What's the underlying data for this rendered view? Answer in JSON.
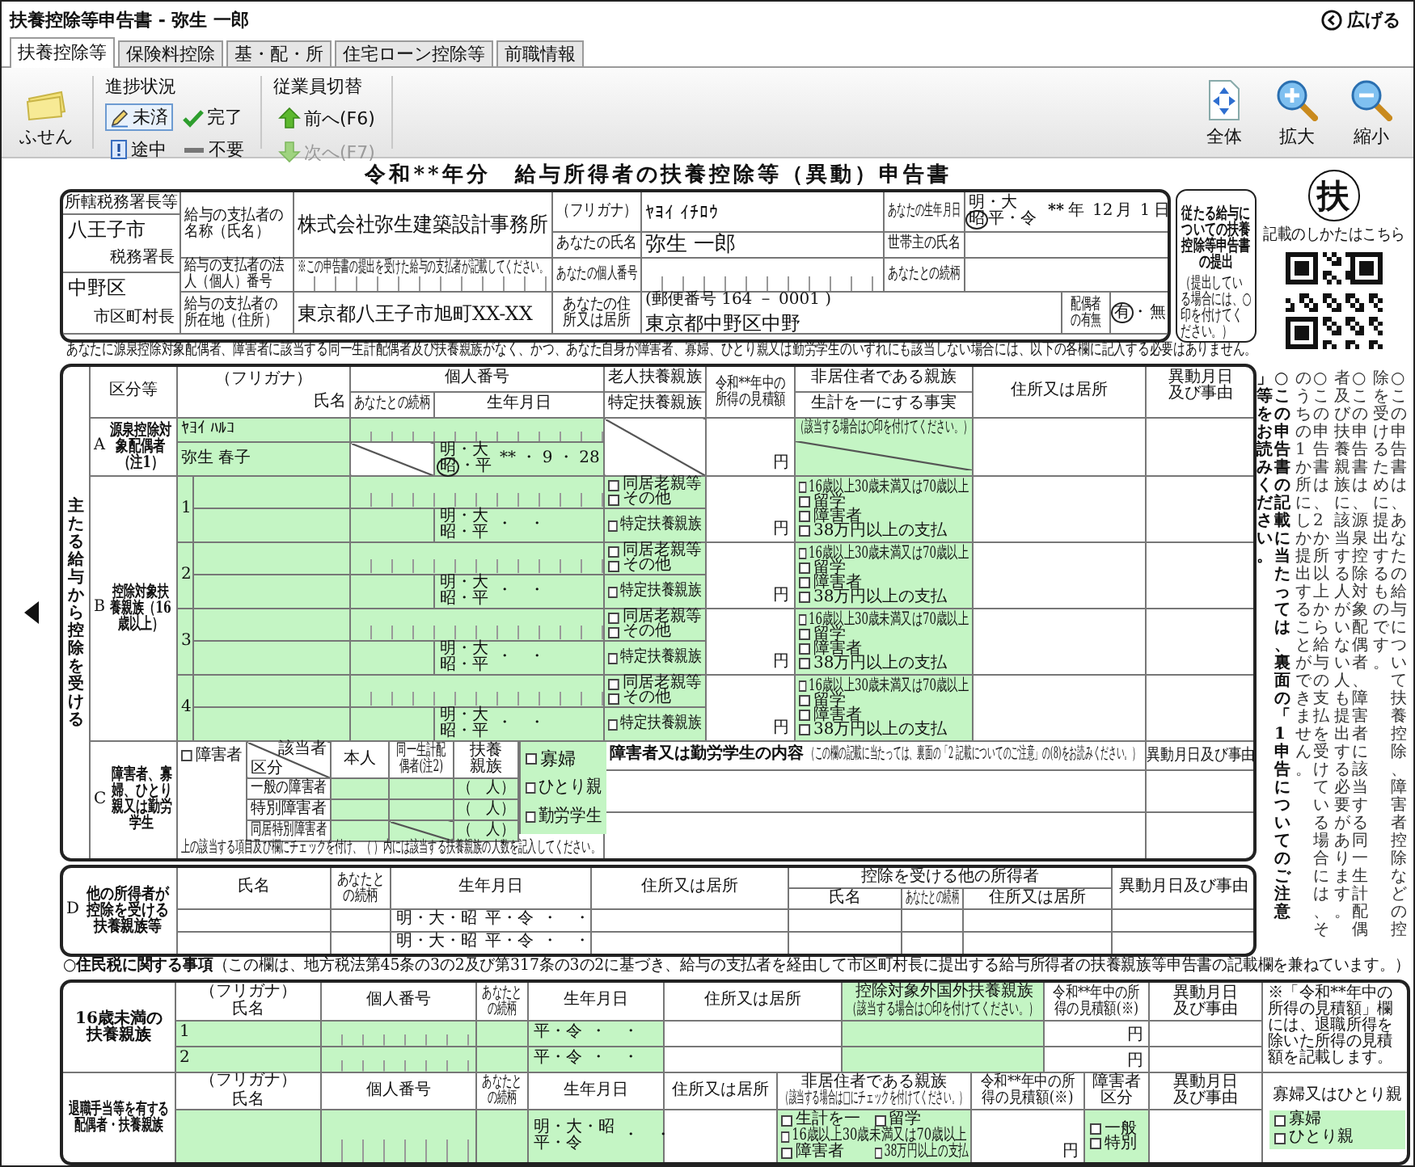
{
  "window": {
    "title": "扶養控除等申告書 - 弥生 一郎",
    "expand_button": "広げる"
  },
  "tabs": [
    {
      "label": "扶養控除等",
      "selected": true
    },
    {
      "label": "保険料控除",
      "selected": false
    },
    {
      "label": "基・配・所",
      "selected": false
    },
    {
      "label": "住宅ローン控除等",
      "selected": false
    },
    {
      "label": "前職情報",
      "selected": false
    }
  ],
  "toolbar": {
    "sticky_note": "ふせん",
    "progress": {
      "title": "進捗状況",
      "items": [
        {
          "label": "未済",
          "kind": "pending",
          "selected": true
        },
        {
          "label": "完了",
          "kind": "done",
          "selected": false
        },
        {
          "label": "途中",
          "kind": "partial",
          "selected": false
        },
        {
          "label": "不要",
          "kind": "unneeded",
          "selected": false
        }
      ]
    },
    "employee_switch": {
      "title": "従業員切替",
      "items": [
        {
          "label": "前へ(F6)",
          "kind": "prev",
          "disabled": false
        },
        {
          "label": "次へ(F7)",
          "kind": "next",
          "disabled": true
        }
      ]
    },
    "view_buttons": [
      {
        "label": "全体",
        "kind": "fit"
      },
      {
        "label": "拡大",
        "kind": "zoom_in"
      },
      {
        "label": "縮小",
        "kind": "zoom_out"
      }
    ]
  },
  "form": {
    "title": "令和**年分　給与所得者の扶養控除等（異動）申告書",
    "header": {
      "tax_office_label": "所轄税務署長等",
      "tax_office": "八王子市",
      "tax_office_suffix": "税務署長",
      "municipality": "中野区",
      "municipality_suffix": "市区町村長",
      "payer_name_label": "給与の支払者の名称（氏名）",
      "payer_name": "株式会社弥生建築設計事務所",
      "payer_number_label": "給与の支払者の法人（個人）番号",
      "payer_number_note": "※この申告書の提出を受けた給与の支払者が記載してください。",
      "payer_address_label": "給与の支払者の所在地（住所）",
      "payer_address": "東京都八王子市旭町XX-XX",
      "furigana_label": "（フリガナ）",
      "furigana": "ﾔﾖｲ ｲﾁﾛｳ",
      "name_label": "あなたの氏名",
      "name": "弥生 一郎",
      "my_number_label": "あなたの個人番号",
      "address_label": "あなたの住所又は居所",
      "postal_code": "(郵便番号 164 － 0001 )",
      "address": "東京都中野区中野",
      "birth_label": "あなたの生年月日",
      "birth_era": [
        {
          "label": "明・大",
          "selected": false
        },
        {
          "label": "昭",
          "selected": true
        },
        {
          "label": "平・令",
          "selected": false
        }
      ],
      "birth_year": "**",
      "year_unit": "年",
      "birth_month": "12",
      "month_unit": "月",
      "birth_day": "1",
      "day_unit": "日",
      "householder_label": "世帯主の氏名",
      "relation_label": "あなたとの続柄",
      "spouse_label": "配偶者の有無",
      "spouse_options": [
        {
          "label": "有",
          "selected": true
        },
        {
          "label": "無",
          "selected": false
        }
      ],
      "spouse_separator": "・",
      "secondary_label": "従たる給与についての扶養控除等申告書の提出",
      "secondary_note": "（提出している場合には、○印を付けてください。）"
    },
    "notice": "あなたに源泉控除対象配偶者、障害者に該当する同一生計配偶者及び扶養親族がなく、かつ、あなた自身が障害者、寡婦、ひとり親又は勤労学生のいずれにも該当しない場合には、以下の各欄に記入する必要はありません。",
    "main": {
      "side_label": "主たる給与から控除を受ける",
      "headers": {
        "category": "区分等",
        "furigana": "（フリガナ）",
        "name": "氏名",
        "number": "個人番号",
        "relation": "あなたとの続柄",
        "birth": "生年月日",
        "elderly": "老人扶養親族",
        "specified": "特定扶養親族",
        "income": "令和**年中の所得の見積額",
        "nonresident": "非居住者である親族",
        "livelihood": "生計を一にする事実",
        "address": "住所又は居所",
        "change": "異動月日及び事由"
      },
      "spouse": {
        "letter": "A",
        "label": "源泉控除対象配偶者（注1）",
        "furigana": "ﾔﾖｲ ﾊﾙｺ",
        "name": "弥生 春子",
        "era": [
          {
            "label": "明・大",
            "selected": false
          },
          {
            "label": "昭",
            "selected": true
          },
          {
            "label": "・平",
            "selected": false
          }
        ],
        "birth": "** ・ 9 ・ 28",
        "yen": "円",
        "note": "（該当する場合は○印を付けてください。）"
      },
      "dependents": {
        "letter": "B",
        "label": "控除対象扶養親族（16歳以上）",
        "rows": [
          {
            "number": "1",
            "era": [
              {
                "label": "明・大",
                "selected": false
              },
              {
                "label": "昭・平",
                "selected": false
              }
            ],
            "birth": "・　・",
            "checks": [
              {
                "label": "同居老親等",
                "checked": false
              },
              {
                "label": "その他",
                "checked": false
              },
              {
                "label": "特定扶養親族",
                "checked": false
              }
            ],
            "yen": "円",
            "nonresident": [
              {
                "label": "16歳以上30歳未満又は70歳以上",
                "checked": false
              },
              {
                "label": "留学",
                "checked": false
              },
              {
                "label": "障害者",
                "checked": false
              },
              {
                "label": "38万円以上の支払",
                "checked": false
              }
            ]
          },
          {
            "number": "2",
            "era": [
              {
                "label": "明・大",
                "selected": false
              },
              {
                "label": "昭・平",
                "selected": false
              }
            ],
            "birth": "・　・",
            "checks": [
              {
                "label": "同居老親等",
                "checked": false
              },
              {
                "label": "その他",
                "checked": false
              },
              {
                "label": "特定扶養親族",
                "checked": false
              }
            ],
            "yen": "円",
            "nonresident": [
              {
                "label": "16歳以上30歳未満又は70歳以上",
                "checked": false
              },
              {
                "label": "留学",
                "checked": false
              },
              {
                "label": "障害者",
                "checked": false
              },
              {
                "label": "38万円以上の支払",
                "checked": false
              }
            ]
          },
          {
            "number": "3",
            "era": [
              {
                "label": "明・大",
                "selected": false
              },
              {
                "label": "昭・平",
                "selected": false
              }
            ],
            "birth": "・　・",
            "checks": [
              {
                "label": "同居老親等",
                "checked": false
              },
              {
                "label": "その他",
                "checked": false
              },
              {
                "label": "特定扶養親族",
                "checked": false
              }
            ],
            "yen": "円",
            "nonresident": [
              {
                "label": "16歳以上30歳未満又は70歳以上",
                "checked": false
              },
              {
                "label": "留学",
                "checked": false
              },
              {
                "label": "障害者",
                "checked": false
              },
              {
                "label": "38万円以上の支払",
                "checked": false
              }
            ]
          },
          {
            "number": "4",
            "era": [
              {
                "label": "明・大",
                "selected": false
              },
              {
                "label": "昭・平",
                "selected": false
              }
            ],
            "birth": "・　・",
            "checks": [
              {
                "label": "同居老親等",
                "checked": false
              },
              {
                "label": "その他",
                "checked": false
              },
              {
                "label": "特定扶養親族",
                "checked": false
              }
            ],
            "yen": "円",
            "nonresident": [
              {
                "label": "16歳以上30歳未満又は70歳以上",
                "checked": false
              },
              {
                "label": "留学",
                "checked": false
              },
              {
                "label": "障害者",
                "checked": false
              },
              {
                "label": "38万円以上の支払",
                "checked": false
              }
            ]
          }
        ]
      },
      "disability": {
        "letter": "C",
        "label": "障害者、寡婦、ひとり親又は勤労学生",
        "check": {
          "label": "障害者",
          "checked": false
        },
        "corner_top": "該当者",
        "corner_bottom": "区分",
        "columns": [
          "本人",
          "同一生計配偶者(注2)",
          "扶養親族"
        ],
        "rows": [
          {
            "label": "一般の障害者",
            "count": "（　人）"
          },
          {
            "label": "特別障害者",
            "count": "（　人）"
          },
          {
            "label": "同居特別障害者",
            "count": "（　人）"
          }
        ],
        "status_checks": [
          {
            "label": "寡婦",
            "checked": false
          },
          {
            "label": "ひとり親",
            "checked": false
          },
          {
            "label": "勤労学生",
            "checked": false
          }
        ],
        "note": "上の該当する項目及び欄にチェックを付け、（ ）内には該当する扶養親族の人数を記入してください。",
        "detail_label": "障害者又は勤労学生の内容",
        "detail_note": "（この欄の記載に当たっては、裏面の「2 記載についてのご注意」の(8)をお読みください。）",
        "change": "異動月日及び事由"
      }
    },
    "other_dependents": {
      "letter": "D",
      "label": "他の所得者が控除を受ける扶養親族等",
      "headers": {
        "name": "氏名",
        "relation": "あなたとの続柄",
        "birth": "生年月日",
        "address": "住所又は居所",
        "other_earner": "控除を受ける他の所得者",
        "earner_name": "氏名",
        "earner_relation": "あなたとの続柄",
        "earner_address": "住所又は居所",
        "change": "異動月日及び事由"
      },
      "rows": [
        {
          "era": [
            {
              "label": "明・大・昭",
              "selected": false
            },
            {
              "label": "平・令",
              "selected": false
            }
          ],
          "birth": "・　・"
        },
        {
          "era": [
            {
              "label": "明・大・昭",
              "selected": false
            },
            {
              "label": "平・令",
              "selected": false
            }
          ],
          "birth": "・　・"
        }
      ]
    },
    "residence_notice": "**○住民税に関する事項**（この欄は、地方税法第45条の3の2及び第317条の3の2に基づき、給与の支払者を経由して市区町村長に提出する給与所得者の扶養親族等申告書の記載欄を兼ねています。）",
    "residence": {
      "under16": {
        "label": "16歳未満の扶養親族",
        "headers": {
          "furigana": "（フリガナ）",
          "name": "氏名",
          "number": "個人番号",
          "relation": "あなたとの続柄",
          "birth": "生年月日",
          "address": "住所又は居所",
          "foreign": "控除対象外国外扶養親族",
          "foreign_note": "（該当する場合は○印を付けてください。）",
          "income": "令和**年中の所得の見積額(※)",
          "change": "異動月日及び事由"
        },
        "rows": [
          {
            "number": "1",
            "era": [
              {
                "label": "平・令",
                "selected": false
              }
            ],
            "birth": "・　・",
            "yen": "円"
          },
          {
            "number": "2",
            "era": [
              {
                "label": "平・令",
                "selected": false
              }
            ],
            "birth": "・　・",
            "yen": "円"
          }
        ],
        "note": "※「令和**年中の所得の見積額」欄には、退職所得を除いた所得の見積額を記載します。"
      },
      "retirement": {
        "label": "退職手当等を有する配偶者・扶養親族",
        "headers": {
          "furigana": "（フリガナ）",
          "name": "氏名",
          "number": "個人番号",
          "relation": "あなたとの続柄",
          "birth": "生年月日",
          "address": "住所又は居所",
          "nonresident": "非居住者である親族",
          "nonresident_note": "（該当する場合は□にチェックを付けてください。）",
          "income": "令和**年中の所得の見積額(※)",
          "disability": "障害者区分",
          "change": "異動月日及び事由"
        },
        "row": {
          "era": [
            {
              "label": "明・大・昭",
              "selected": false
            },
            {
              "label": "平・令",
              "selected": false
            }
          ],
          "birth": "・　・",
          "nonresident": [
            {
              "label": "生計を一",
              "checked": false
            },
            {
              "label": "留学",
              "checked": false
            },
            {
              "label": "16歳以上30歳未満又は70歳以上",
              "checked": false
            },
            {
              "label": "障害者",
              "checked": false
            },
            {
              "label": "38万円以上の支払",
              "checked": false
            }
          ],
          "yen": "円",
          "disability_checks": [
            {
              "label": "一般",
              "checked": false
            },
            {
              "label": "特別",
              "checked": false
            }
          ]
        },
        "widow_label": "寡婦又はひとり親",
        "widow_checks": [
          {
            "label": "寡婦",
            "checked": false
          },
          {
            "label": "ひとり親",
            "checked": false
          }
        ]
      }
    },
    "side": {
      "badge": "扶",
      "qr_caption": "記載のしかたはこちら",
      "notes": "○この申告書は、あなたの給与について扶養控除、障害者控除などの控除を受けるために提出するものです。\n○この申告書は、源泉控除対象配偶者、障害者に該当する同一生計配偶者及び扶養親族に該当する人がいない人も提出する必要があります。\n○この申告書は、2か所以上から給与の支払を受けている場合には、そのうちの1か所にしか提出することができません。\n**○この申告書の記載に当たっては、裏面の「1　申告についてのご注意」等をお読みください。**"
    }
  }
}
